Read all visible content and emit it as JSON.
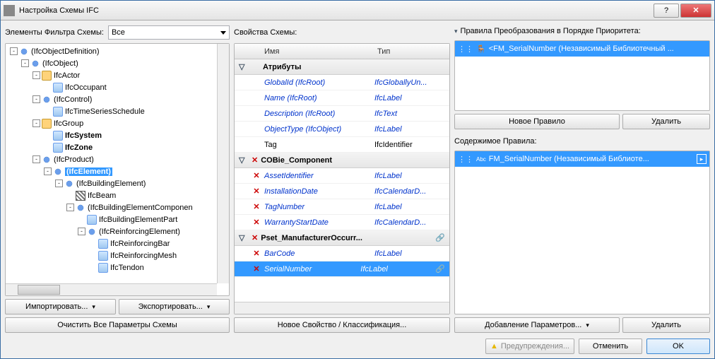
{
  "title": "Настройка Схемы IFC",
  "filter": {
    "label": "Элементы Фильтра Схемы:",
    "value": "Все"
  },
  "treeButtons": {
    "import": "Импортировать...",
    "export": "Экспортировать...",
    "clear": "Очистить Все Параметры Схемы"
  },
  "schemaLabel": "Свойства Схемы:",
  "schemaHeaders": {
    "name": "Имя",
    "type": "Тип"
  },
  "schemaGroups": [
    {
      "label": "Атрибуты",
      "hasX": false,
      "items": [
        {
          "name": "GlobalId (IfcRoot)",
          "type": "IfcGloballyUn...",
          "style": "link"
        },
        {
          "name": "Name (IfcRoot)",
          "type": "IfcLabel",
          "style": "link"
        },
        {
          "name": "Description (IfcRoot)",
          "type": "IfcText",
          "style": "link"
        },
        {
          "name": "ObjectType (IfcObject)",
          "type": "IfcLabel",
          "style": "link"
        },
        {
          "name": "Tag",
          "type": "IfcIdentifier",
          "style": "plain"
        }
      ]
    },
    {
      "label": "COBie_Component",
      "hasX": true,
      "items": [
        {
          "name": "AssetIdentifier",
          "type": "IfcLabel",
          "x": true
        },
        {
          "name": "InstallationDate",
          "type": "IfcCalendarD...",
          "x": true
        },
        {
          "name": "TagNumber",
          "type": "IfcLabel",
          "x": true
        },
        {
          "name": "WarrantyStartDate",
          "type": "IfcCalendarD...",
          "x": true
        }
      ]
    },
    {
      "label": "Pset_ManufacturerOccurr...",
      "hasX": true,
      "link": true,
      "items": [
        {
          "name": "BarCode",
          "type": "IfcLabel",
          "x": true
        },
        {
          "name": "SerialNumber",
          "type": "IfcLabel",
          "x": true,
          "sel": true,
          "link": true
        }
      ]
    }
  ],
  "newProperty": "Новое Свойство / Классификация...",
  "rulesLabel": "Правила Преобразования в Порядке Приоритета:",
  "ruleText": "<FM_SerialNumber (Независимый Библиотечный ...",
  "newRule": "Новое Правило",
  "deleteRule": "Удалить",
  "contentLabel": "Содержимое Правила:",
  "contentText": "FM_SerialNumber (Независимый Библиоте...",
  "addParams": "Добавление Параметров...",
  "deleteContent": "Удалить",
  "footer": {
    "warn": "Предупреждения...",
    "cancel": "Отменить",
    "ok": "OK"
  },
  "tree": [
    {
      "d": 0,
      "exp": "-",
      "i": "node",
      "t": "(IfcObjectDefinition)"
    },
    {
      "d": 1,
      "exp": "-",
      "i": "node",
      "t": "(IfcObject)"
    },
    {
      "d": 2,
      "exp": "-",
      "i": "obj",
      "t": "IfcActor"
    },
    {
      "d": 3,
      "exp": "",
      "i": "leaf",
      "t": "IfcOccupant"
    },
    {
      "d": 2,
      "exp": "-",
      "i": "node",
      "t": "(IfcControl)"
    },
    {
      "d": 3,
      "exp": "",
      "i": "leaf",
      "t": "IfcTimeSeriesSchedule"
    },
    {
      "d": 2,
      "exp": "-",
      "i": "obj",
      "t": "IfcGroup"
    },
    {
      "d": 3,
      "exp": "",
      "i": "leaf",
      "t": "IfcSystem",
      "bold": true
    },
    {
      "d": 3,
      "exp": "",
      "i": "leaf",
      "t": "IfcZone",
      "bold": true
    },
    {
      "d": 2,
      "exp": "-",
      "i": "node",
      "t": "(IfcProduct)"
    },
    {
      "d": 3,
      "exp": "-",
      "i": "node",
      "t": "(IfcElement)",
      "sel": true,
      "bold": true
    },
    {
      "d": 4,
      "exp": "-",
      "i": "node",
      "t": "(IfcBuildingElement)"
    },
    {
      "d": 5,
      "exp": "",
      "i": "hatch",
      "t": "IfcBeam"
    },
    {
      "d": 5,
      "exp": "-",
      "i": "node",
      "t": "(IfcBuildingElementComponen"
    },
    {
      "d": 6,
      "exp": "",
      "i": "leaf",
      "t": "IfcBuildingElementPart"
    },
    {
      "d": 6,
      "exp": "-",
      "i": "node",
      "t": "(IfcReinforcingElement)"
    },
    {
      "d": 7,
      "exp": "",
      "i": "leaf",
      "t": "IfcReinforcingBar"
    },
    {
      "d": 7,
      "exp": "",
      "i": "leaf",
      "t": "IfcReinforcingMesh"
    },
    {
      "d": 7,
      "exp": "",
      "i": "leaf",
      "t": "IfcTendon"
    }
  ]
}
